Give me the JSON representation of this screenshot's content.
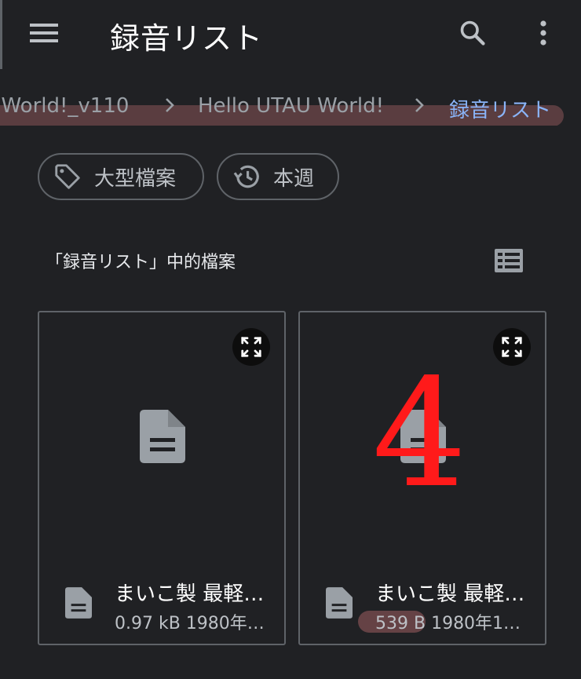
{
  "appbar": {
    "title": "録音リスト",
    "menu_icon": "menu-icon",
    "search_icon": "search-icon",
    "more_icon": "more-vert-icon"
  },
  "breadcrumb": {
    "items": [
      "l World!_v110",
      "Hello UTAU World!",
      "録音リスト"
    ],
    "active_color": "#8ab4f8"
  },
  "chips": [
    {
      "label": "大型檔案",
      "icon": "tag-icon"
    },
    {
      "label": "本週",
      "icon": "history-icon"
    }
  ],
  "section": {
    "title": "「録音リスト」中的檔案",
    "view_icon": "list-view-icon"
  },
  "files": [
    {
      "name": "まいこ製 最軽…",
      "meta": "0.97 kB 1980年…",
      "icon": "document-icon"
    },
    {
      "name": "まいこ製 最軽…",
      "meta": "539 B 1980年1…",
      "icon": "document-icon"
    }
  ],
  "overlay": {
    "label": "4",
    "color": "#ff1a1a"
  }
}
